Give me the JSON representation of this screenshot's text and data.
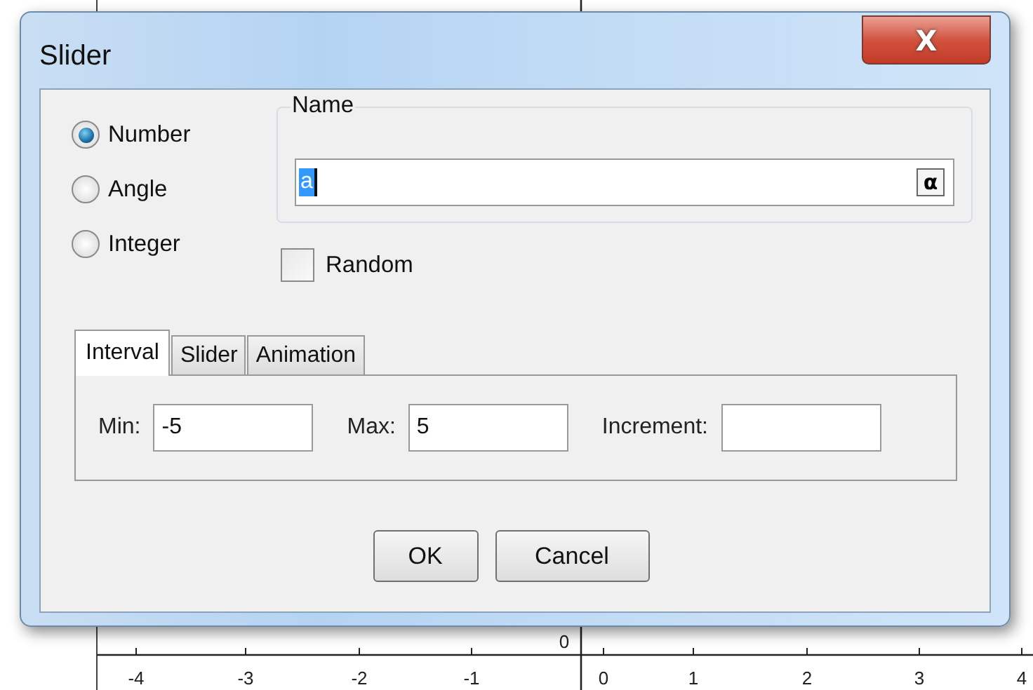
{
  "graph": {
    "x_labels": [
      "-4",
      "-3",
      "-2",
      "-1",
      "0",
      "1",
      "2",
      "3",
      "4"
    ],
    "origin_label": "0"
  },
  "window": {
    "title": "Slider",
    "close": "X"
  },
  "types": [
    {
      "label": "Number",
      "selected": true
    },
    {
      "label": "Angle",
      "selected": false
    },
    {
      "label": "Integer",
      "selected": false
    }
  ],
  "name": {
    "legend": "Name",
    "value": "a",
    "symbol_button": "α"
  },
  "random": {
    "label": "Random",
    "checked": false
  },
  "tabs": [
    {
      "label": "Interval",
      "selected": true
    },
    {
      "label": "Slider",
      "selected": false
    },
    {
      "label": "Animation",
      "selected": false
    }
  ],
  "interval": [
    {
      "label": "Min:",
      "value": "-5"
    },
    {
      "label": "Max:",
      "value": "5"
    },
    {
      "label": "Increment:"
    }
  ],
  "buttons": [
    "OK",
    "Cancel"
  ]
}
